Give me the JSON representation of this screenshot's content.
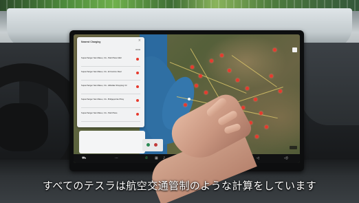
{
  "caption": "すべてのテスラは航空交通管制のような計算をしています",
  "screen": {
    "panel": {
      "title": "Nearest Charging",
      "close_glyph": "×",
      "more_glyph": "•••",
      "items": [
        {
          "name": "Supercharger San Mateo, CA - Park Place Mall"
        },
        {
          "name": "Supercharger San Mateo, CA - El Camino Real"
        },
        {
          "name": "Supercharger San Mateo, CA - Hillsdale Shopping Ctr"
        },
        {
          "name": "Supercharger San Mateo, CA - Bridgepointe Pkwy"
        },
        {
          "name": "Supercharger San Mateo, CA - Park Place"
        }
      ]
    },
    "taskbar_icons": [
      "car-icon",
      "phone-icon",
      "apps-icon",
      "music-icon",
      "fan-icon",
      "volume-icon"
    ],
    "taskbar_glyphs": [
      "⛟",
      "⋯",
      "✆",
      "▦",
      "♪",
      "✱",
      "◁",
      "◁)"
    ]
  },
  "colors": {
    "charger_pin": "#e63a2e",
    "water": "#2f6fa3",
    "caption": "#ffffff"
  }
}
